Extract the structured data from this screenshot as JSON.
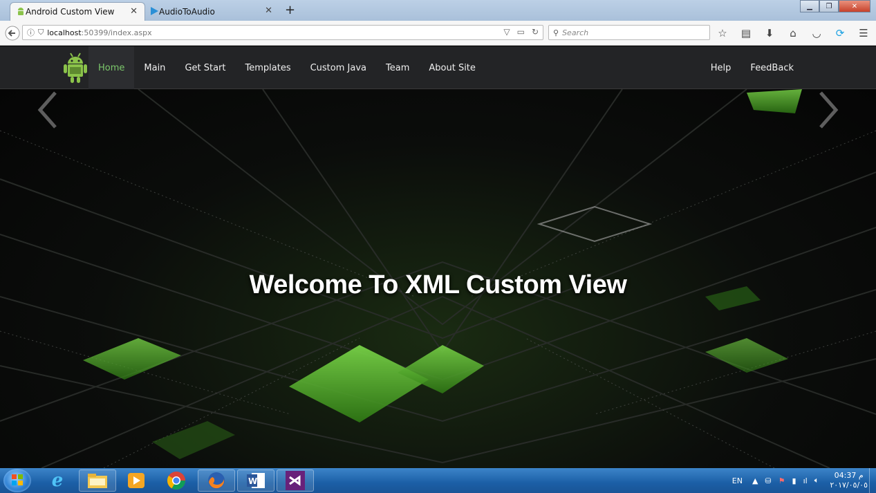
{
  "browser": {
    "tabs": [
      {
        "title": "Android Custom View",
        "active": true
      },
      {
        "title": "AudioToAudio",
        "active": false
      }
    ],
    "new_tab": "+",
    "url": {
      "host": "localhost",
      "path": ":50399/index.aspx"
    },
    "search_placeholder": "Search"
  },
  "site": {
    "nav": {
      "left": [
        {
          "label": "Home",
          "active": true
        },
        {
          "label": "Main"
        },
        {
          "label": "Get Start"
        },
        {
          "label": "Templates"
        },
        {
          "label": "Custom Java"
        },
        {
          "label": "Team"
        },
        {
          "label": "About Site"
        }
      ],
      "right": [
        {
          "label": "Help"
        },
        {
          "label": "FeedBack"
        }
      ]
    },
    "hero": {
      "title": "Welcome To XML Custom View"
    }
  },
  "colors": {
    "accent": "#7cc86b",
    "nav_bg": "#232426",
    "android_green": "#8bc34a"
  },
  "taskbar": {
    "apps": [
      "windows-start",
      "internet-explorer",
      "file-explorer",
      "media-player",
      "chrome",
      "firefox",
      "word",
      "visual-studio"
    ],
    "lang": "EN",
    "time": "04:37 م",
    "date": "٢٠١٧/٠٥/٠٥"
  }
}
